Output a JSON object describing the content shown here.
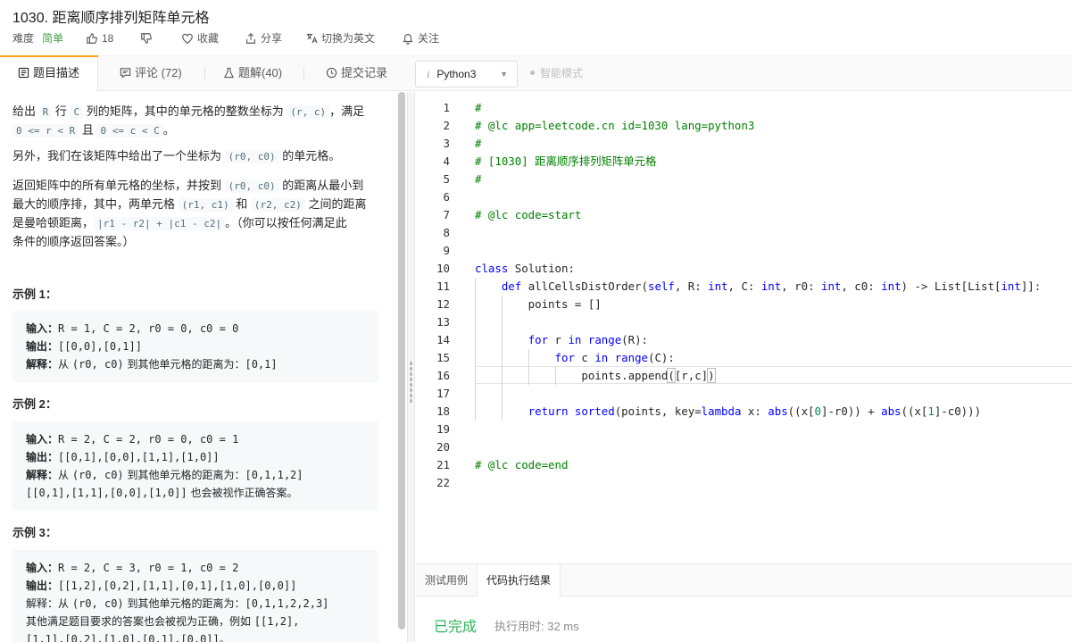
{
  "header": {
    "title": "1030. 距离顺序排列矩阵单元格",
    "difficulty_label": "难度",
    "difficulty_value": "简单",
    "likes": "18",
    "favorite": "收藏",
    "share": "分享",
    "switch_lang": "切换为英文",
    "follow": "关注"
  },
  "tabs": {
    "description": "题目描述",
    "comments": "评论 (72)",
    "solutions": "题解(40)",
    "submissions": "提交记录",
    "language": "Python3",
    "smart_mode": "智能模式"
  },
  "description": {
    "p1": [
      "给出 ",
      "R",
      " 行 ",
      "C",
      " 列的矩阵，其中的单元格的整数坐标为 ",
      "(r, c)",
      "，满足",
      "0 <= r < R",
      " 且 ",
      "0 <= c < C",
      "。"
    ],
    "p2": [
      "另外，我们在该矩阵中给出了一个坐标为 ",
      "(r0, c0)",
      " 的单元格。"
    ],
    "p3": [
      "返回矩阵中的所有单元格的坐标，并按到 ",
      "(r0, c0)",
      " 的距离从最小到",
      "最大的顺序排，其中，两单元格 ",
      "(r1, c1)",
      " 和 ",
      "(r2, c2)",
      " 之间的距离",
      "是曼哈顿距离，",
      "|r1 - r2| + |c1 - c2|",
      "。（你可以按任何满足此",
      "条件的顺序返回答案。）"
    ]
  },
  "examples": [
    {
      "title": "示例 1：",
      "input_label": "输入：",
      "input": "R = 1, C = 2, r0 = 0, c0 = 0",
      "output_label": "输出：",
      "output": "[[0,0],[0,1]]",
      "explain_label": "解释：",
      "explain_cn1": "从 ",
      "explain_code": "(r0, c0)",
      "explain_cn2": " 到其他单元格的距离为：",
      "explain_val": "[0,1]"
    },
    {
      "title": "示例 2：",
      "input_label": "输入：",
      "input": "R = 2, C = 2, r0 = 0, c0 = 1",
      "output_label": "输出：",
      "output": "[[0,1],[0,0],[1,1],[1,0]]",
      "explain_label": "解释：",
      "explain_cn1": "从 ",
      "explain_code": "(r0, c0)",
      "explain_cn2": " 到其他单元格的距离为：",
      "explain_val": "[0,1,1,2]",
      "extra_code": "[[0,1],[1,1],[0,0],[1,0]]",
      "extra_cn": " 也会被视作正确答案。"
    },
    {
      "title": "示例 3：",
      "input_label": "输入：",
      "input": "R = 2, C = 3, r0 = 1, c0 = 2",
      "output_label": "输出：",
      "output": "[[1,2],[0,2],[1,1],[0,1],[1,0],[0,0]]",
      "explain_label": "解释：",
      "explain_cn1": "从 ",
      "explain_code": "(r0, c0)",
      "explain_cn2": " 到其他单元格的距离为：",
      "explain_val": "[0,1,1,2,2,3]",
      "extra_cn": "其他满足题目要求的答案也会被视为正确，例如 ",
      "extra_code": "[[1,2],",
      "extra_code2": "[1,1],[0,2],[1,0],[0,1],[0,0]]",
      "extra_tail": "。"
    }
  ],
  "code": [
    "#",
    "# @lc app=leetcode.cn id=1030 lang=python3",
    "#",
    "# [1030] 距离顺序排列矩阵单元格",
    "#",
    "",
    "# @lc code=start",
    "",
    "",
    "class Solution:",
    "    def allCellsDistOrder(self, R: int, C: int, r0: int, c0: int) -> List[List[int]]:",
    "        points = []",
    "",
    "        for r in range(R):",
    "            for c in range(C):",
    "                points.append([r,c])",
    "",
    "        return sorted(points, key=lambda x: abs((x[0]-r0)) + abs((x[1]-c0)))",
    "",
    "",
    "# @lc code=end",
    ""
  ],
  "console": {
    "tab_testcase": "测试用例",
    "tab_result": "代码执行结果",
    "status": "已完成",
    "runtime": "执行用时: 32 ms"
  },
  "colors": {
    "accent": "#ffa116",
    "easy": "#43a047",
    "success": "#2db55d"
  }
}
